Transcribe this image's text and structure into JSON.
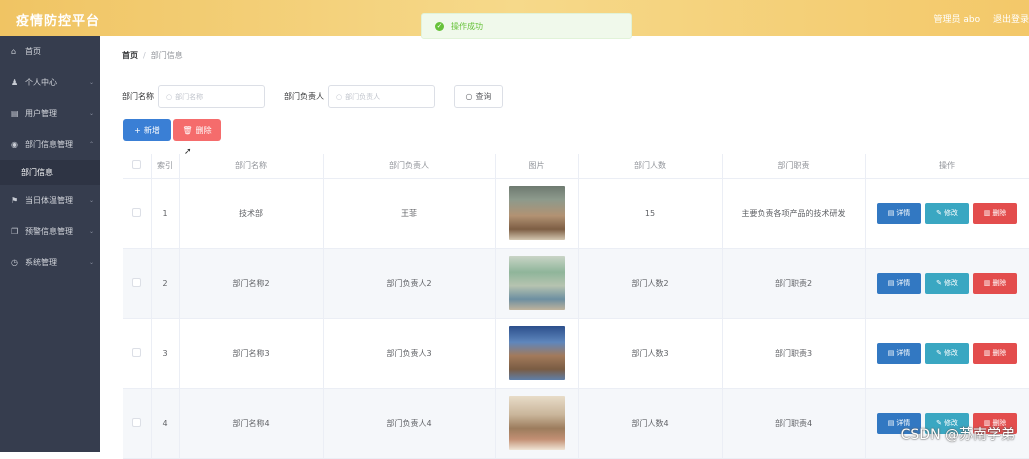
{
  "header": {
    "title": "疫情防控平台",
    "user": "管理员 abo",
    "logout": "退出登录"
  },
  "toast": {
    "message": "操作成功"
  },
  "sidebar": {
    "items": [
      {
        "label": "首页",
        "icon": "home-icon",
        "glyph": "⌂",
        "chevron": false
      },
      {
        "label": "个人中心",
        "icon": "person-icon",
        "glyph": "♟",
        "chevron": true
      },
      {
        "label": "用户管理",
        "icon": "list-icon",
        "glyph": "▤",
        "chevron": true
      },
      {
        "label": "部门信息管理",
        "icon": "location-icon",
        "glyph": "◉",
        "chevron": true
      },
      {
        "label": "当日体温管理",
        "icon": "flag-icon",
        "glyph": "⚑",
        "chevron": true
      },
      {
        "label": "预警信息管理",
        "icon": "copy-icon",
        "glyph": "❐",
        "chevron": true
      },
      {
        "label": "系统管理",
        "icon": "clock-icon",
        "glyph": "◷",
        "chevron": true
      }
    ],
    "sub_item": "部门信息"
  },
  "breadcrumb": {
    "home": "首页",
    "separator": "/",
    "current": "部门信息"
  },
  "search": {
    "name_label": "部门名称",
    "name_placeholder": "部门名称",
    "head_label": "部门负责人",
    "head_placeholder": "部门负责人",
    "query_label": "查询"
  },
  "actions": {
    "add_label": "新增",
    "delete_label": "删除"
  },
  "table": {
    "headers": [
      "",
      "索引",
      "部门名称",
      "部门负责人",
      "图片",
      "部门人数",
      "部门职责",
      "操作"
    ],
    "rows": [
      {
        "index": "1",
        "name": "技术部",
        "head": "王菲",
        "count": "15",
        "duty": "主要负责各项产品的技术研发"
      },
      {
        "index": "2",
        "name": "部门名称2",
        "head": "部门负责人2",
        "count": "部门人数2",
        "duty": "部门职责2"
      },
      {
        "index": "3",
        "name": "部门名称3",
        "head": "部门负责人3",
        "count": "部门人数3",
        "duty": "部门职责3"
      },
      {
        "index": "4",
        "name": "部门名称4",
        "head": "部门负责人4",
        "count": "部门人数4",
        "duty": "部门职责4"
      }
    ],
    "ops": {
      "detail": "详情",
      "edit": "修改",
      "delete": "删除"
    }
  },
  "watermark": "CSDN @苏南学弟"
}
